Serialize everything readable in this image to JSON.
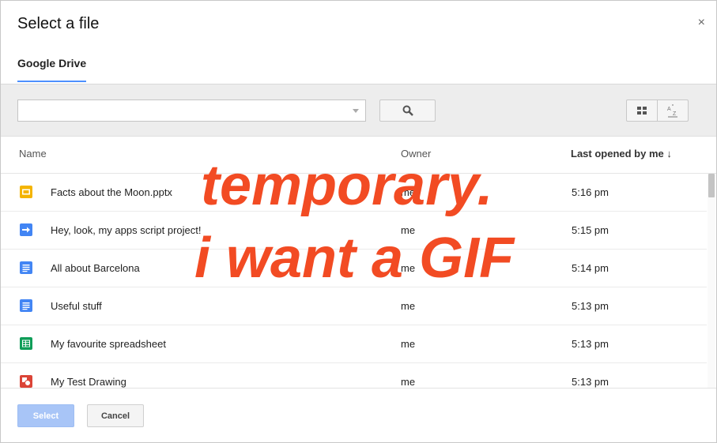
{
  "dialog": {
    "title": "Select a file",
    "close_glyph": "×"
  },
  "tabs": [
    {
      "label": "Google Drive",
      "active": true
    }
  ],
  "toolbar": {
    "search_value": "",
    "search_placeholder": "",
    "search_icon": "search-icon",
    "grid_icon": "grid-view-icon",
    "sort_icon": "sort-az-icon"
  },
  "columns": {
    "name": "Name",
    "owner": "Owner",
    "last_opened": "Last opened by me ↓"
  },
  "files": [
    {
      "name": "Facts about the Moon.pptx",
      "owner": "me",
      "date": "5:16 pm",
      "type": "slides",
      "color": "#f4b400"
    },
    {
      "name": "Hey, look, my apps script project!",
      "owner": "me",
      "date": "5:15 pm",
      "type": "script",
      "color": "#4285f4"
    },
    {
      "name": "All about Barcelona",
      "owner": "me",
      "date": "5:14 pm",
      "type": "doc",
      "color": "#4285f4"
    },
    {
      "name": "Useful stuff",
      "owner": "me",
      "date": "5:13 pm",
      "type": "doc",
      "color": "#4285f4"
    },
    {
      "name": "My favourite spreadsheet",
      "owner": "me",
      "date": "5:13 pm",
      "type": "sheet",
      "color": "#0f9d58"
    },
    {
      "name": "My Test Drawing",
      "owner": "me",
      "date": "5:13 pm",
      "type": "drawing",
      "color": "#db4437"
    }
  ],
  "footer": {
    "select_label": "Select",
    "cancel_label": "Cancel"
  },
  "overlay": {
    "line1": "temporary.",
    "line2": "i want a GIF",
    "color": "#f24b23"
  }
}
